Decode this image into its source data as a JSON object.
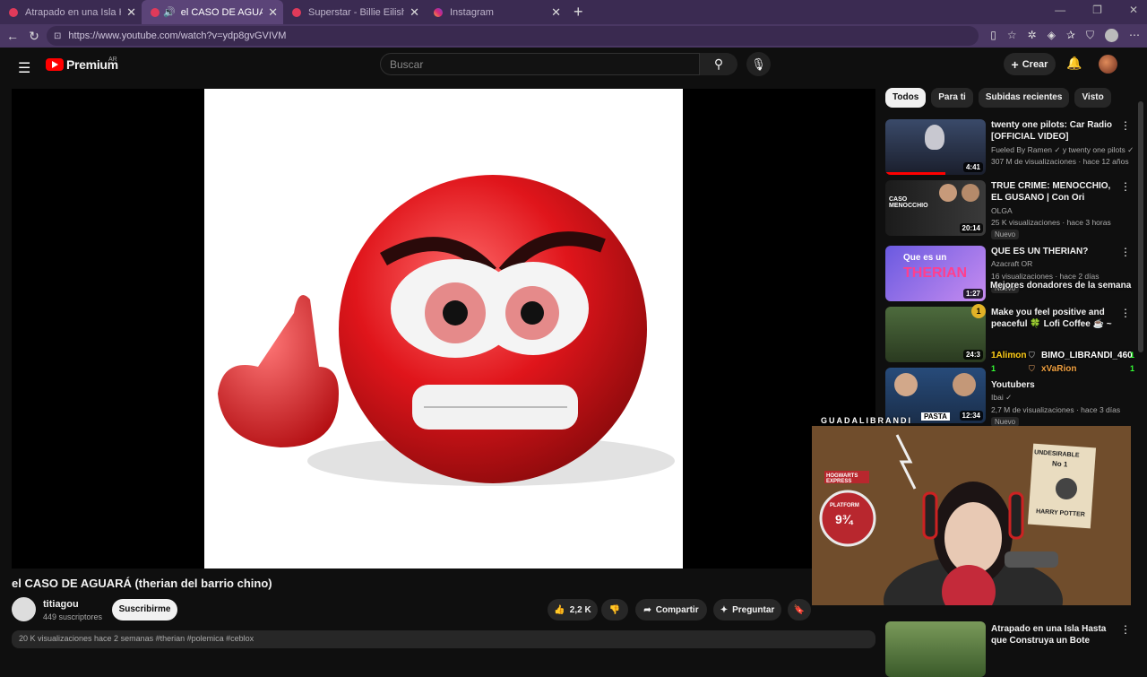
{
  "tabs": [
    {
      "title": "Atrapado en una Isla Hasta que C",
      "close": "✕"
    },
    {
      "title": "el CASO DE AGUARÁ (therian",
      "close": "✕"
    },
    {
      "title": "Superstar - Billie Eilish (unrealeas",
      "close": "✕"
    },
    {
      "title": "Instagram",
      "close": "✕"
    }
  ],
  "browser": {
    "url": "https://www.youtube.com/watch?v=ydp8gvGVIVM",
    "new_tab": "+"
  },
  "header": {
    "logo": "Premium",
    "country": "AR",
    "search_placeholder": "Buscar",
    "create_label": "Crear"
  },
  "video": {
    "title": "el CASO DE AGUARÁ (therian del barrio chino)"
  },
  "channel": {
    "name": "titiagou",
    "subscribers": "449 suscriptores",
    "subscribe_label": "Suscribirme"
  },
  "actions": {
    "likes": "2,2 K",
    "share": "Compartir",
    "ask": "Preguntar"
  },
  "description": {
    "meta": "20 K visualizaciones  hace 2 semanas  #therian #polemica #ceblox"
  },
  "chips": [
    "Todos",
    "Para ti",
    "Subidas recientes",
    "Visto"
  ],
  "recommendations": [
    {
      "title": "twenty one pilots: Car Radio [OFFICIAL VIDEO]",
      "channel": "Fueled By Ramen ✓ y twenty one pilots ✓",
      "meta": "307 M de visualizaciones · hace 12 años",
      "duration": "4:41",
      "badge": ""
    },
    {
      "title": "TRUE CRIME: MENOCCHIO, EL GUSANO | Con Ori Sabatini y ...",
      "channel": "OLGA",
      "meta": "25 K visualizaciones · hace 3 horas",
      "duration": "20:14",
      "badge": "Nuevo",
      "thumb_text": "CASO MENOCCHIO"
    },
    {
      "title": "QUE ES UN THERIAN?",
      "channel": "Azacraft OR",
      "meta": "16 visualizaciones · hace 2 días",
      "duration": "1:27",
      "badge": "Nuevo",
      "thumb_text_1": "Que es un",
      "thumb_text_2": "THERIAN"
    },
    {
      "title": "Make you feel positive and peaceful 🍀 Lofi Coffee ☕ ~ ...",
      "channel": "",
      "meta": "",
      "duration": "24:3",
      "badge": ""
    },
    {
      "title": "Youtubers",
      "channel": "Ibai ✓",
      "meta": "2,7 M de visualizaciones · hace 3 días",
      "duration": "12:34",
      "badge": "Nuevo",
      "thumb_text": "PASTA"
    },
    {
      "title": "Atrapado en una Isla Hasta que Construya un Bote",
      "channel": "",
      "meta": "",
      "duration": "",
      "badge": ""
    }
  ],
  "donors": {
    "title": "Mejores donadores de la semana",
    "rank": "1",
    "entries": [
      {
        "name": "1Alimon",
        "value": "1"
      },
      {
        "name": "BIMO_LIBRANDI_460",
        "value": "1"
      },
      {
        "name": "xVaRion",
        "value": "1"
      }
    ]
  },
  "stream": {
    "label": "GUADALIBRANDI",
    "sign_1": "UNDESIRABLE",
    "sign_2": "No 1",
    "sign_3": "HARRY POTTER",
    "sign_4": "HOGWARTS EXPRESS",
    "sign_5": "PLATFORM",
    "sign_6": "9¾"
  },
  "colors": {
    "yt_red": "#ff0000",
    "emoji_red": "#e0151b",
    "bg": "#0f0f0f",
    "browser_bar": "#4a3763"
  }
}
